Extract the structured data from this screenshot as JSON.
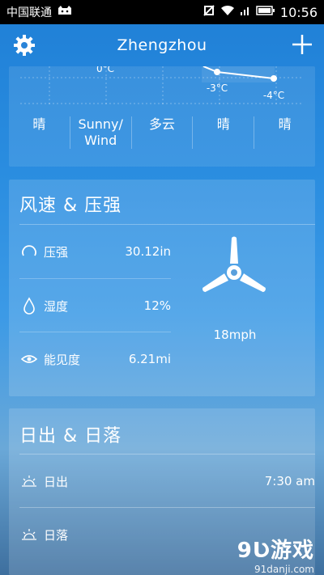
{
  "status_bar": {
    "carrier": "中国联通",
    "time": "10:56"
  },
  "header": {
    "city": "Zhengzhou"
  },
  "forecast": {
    "temps": [
      "0°C",
      "-3°C",
      "-4°C"
    ],
    "conditions": [
      "晴",
      "Sunny/\nWind",
      "多云",
      "晴",
      "晴"
    ]
  },
  "wind_pressure": {
    "title": "风速 & 压强",
    "rows": [
      {
        "label": "压强",
        "value": "30.12in"
      },
      {
        "label": "湿度",
        "value": "12%"
      },
      {
        "label": "能见度",
        "value": "6.21mi"
      }
    ],
    "wind_speed": "18mph"
  },
  "sun": {
    "title": "日出 & 日落",
    "rows": [
      {
        "label": "日出",
        "value": "7:30 am"
      },
      {
        "label": "日落",
        "value": ""
      }
    ]
  },
  "watermark": {
    "brand": "9Ʋ游戏",
    "url": "91danji.com"
  }
}
